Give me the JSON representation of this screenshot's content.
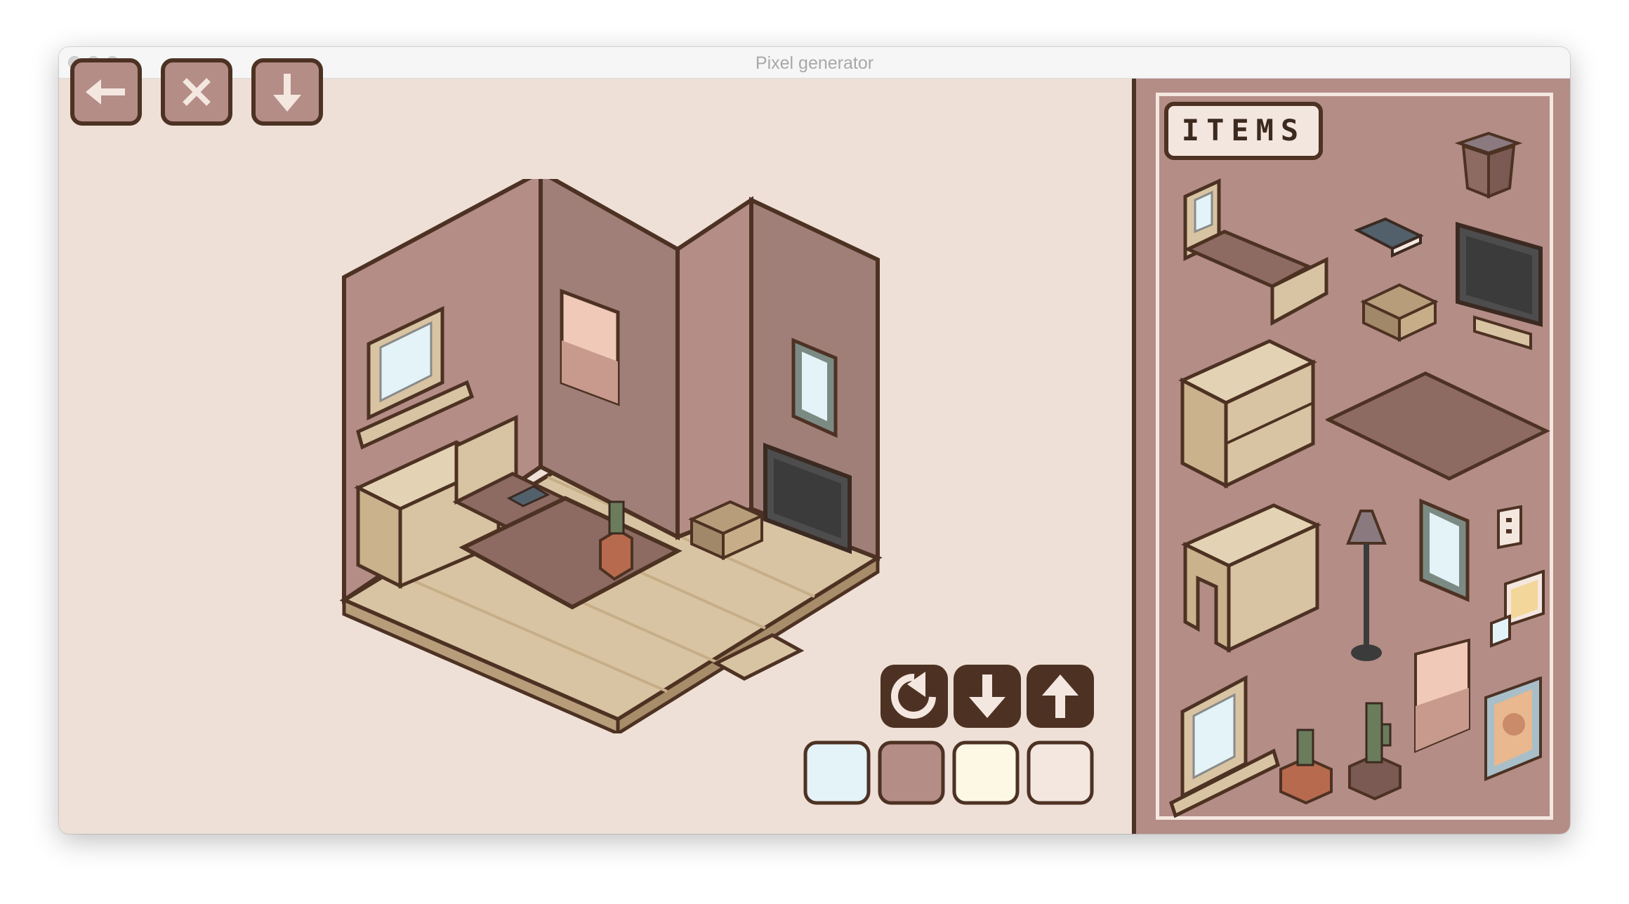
{
  "window": {
    "title": "Pixel generator"
  },
  "toolbar": {
    "buttons": [
      {
        "id": "undo",
        "icon": "arrow-left-icon"
      },
      {
        "id": "clear",
        "icon": "x-icon"
      },
      {
        "id": "download",
        "icon": "arrow-down-icon"
      }
    ]
  },
  "controls": {
    "buttons": [
      {
        "id": "rotate",
        "icon": "rotate-icon"
      },
      {
        "id": "move-down",
        "icon": "arrow-down-icon"
      },
      {
        "id": "move-up",
        "icon": "arrow-up-icon"
      }
    ]
  },
  "palette": {
    "swatches": [
      "#e3f3f8",
      "#b48d86",
      "#fcf8e4",
      "#f4e7e0"
    ]
  },
  "items_panel": {
    "label": "ITEMS",
    "items": [
      "trash-bin-icon",
      "bed-icon",
      "book-icon",
      "tv-icon",
      "basket-icon",
      "dresser-icon",
      "rug-icon",
      "desk-icon",
      "floor-lamp-icon",
      "mirror-icon",
      "wall-outlet-icon",
      "photos-icon",
      "window-icon",
      "small-cactus-icon",
      "tall-cactus-icon",
      "gradient-poster-icon",
      "portrait-icon"
    ]
  },
  "colors": {
    "accent_dark": "#4d3223",
    "wall": "#b48d86",
    "background": "#eee0d7",
    "wood": "#d8c4a2"
  }
}
